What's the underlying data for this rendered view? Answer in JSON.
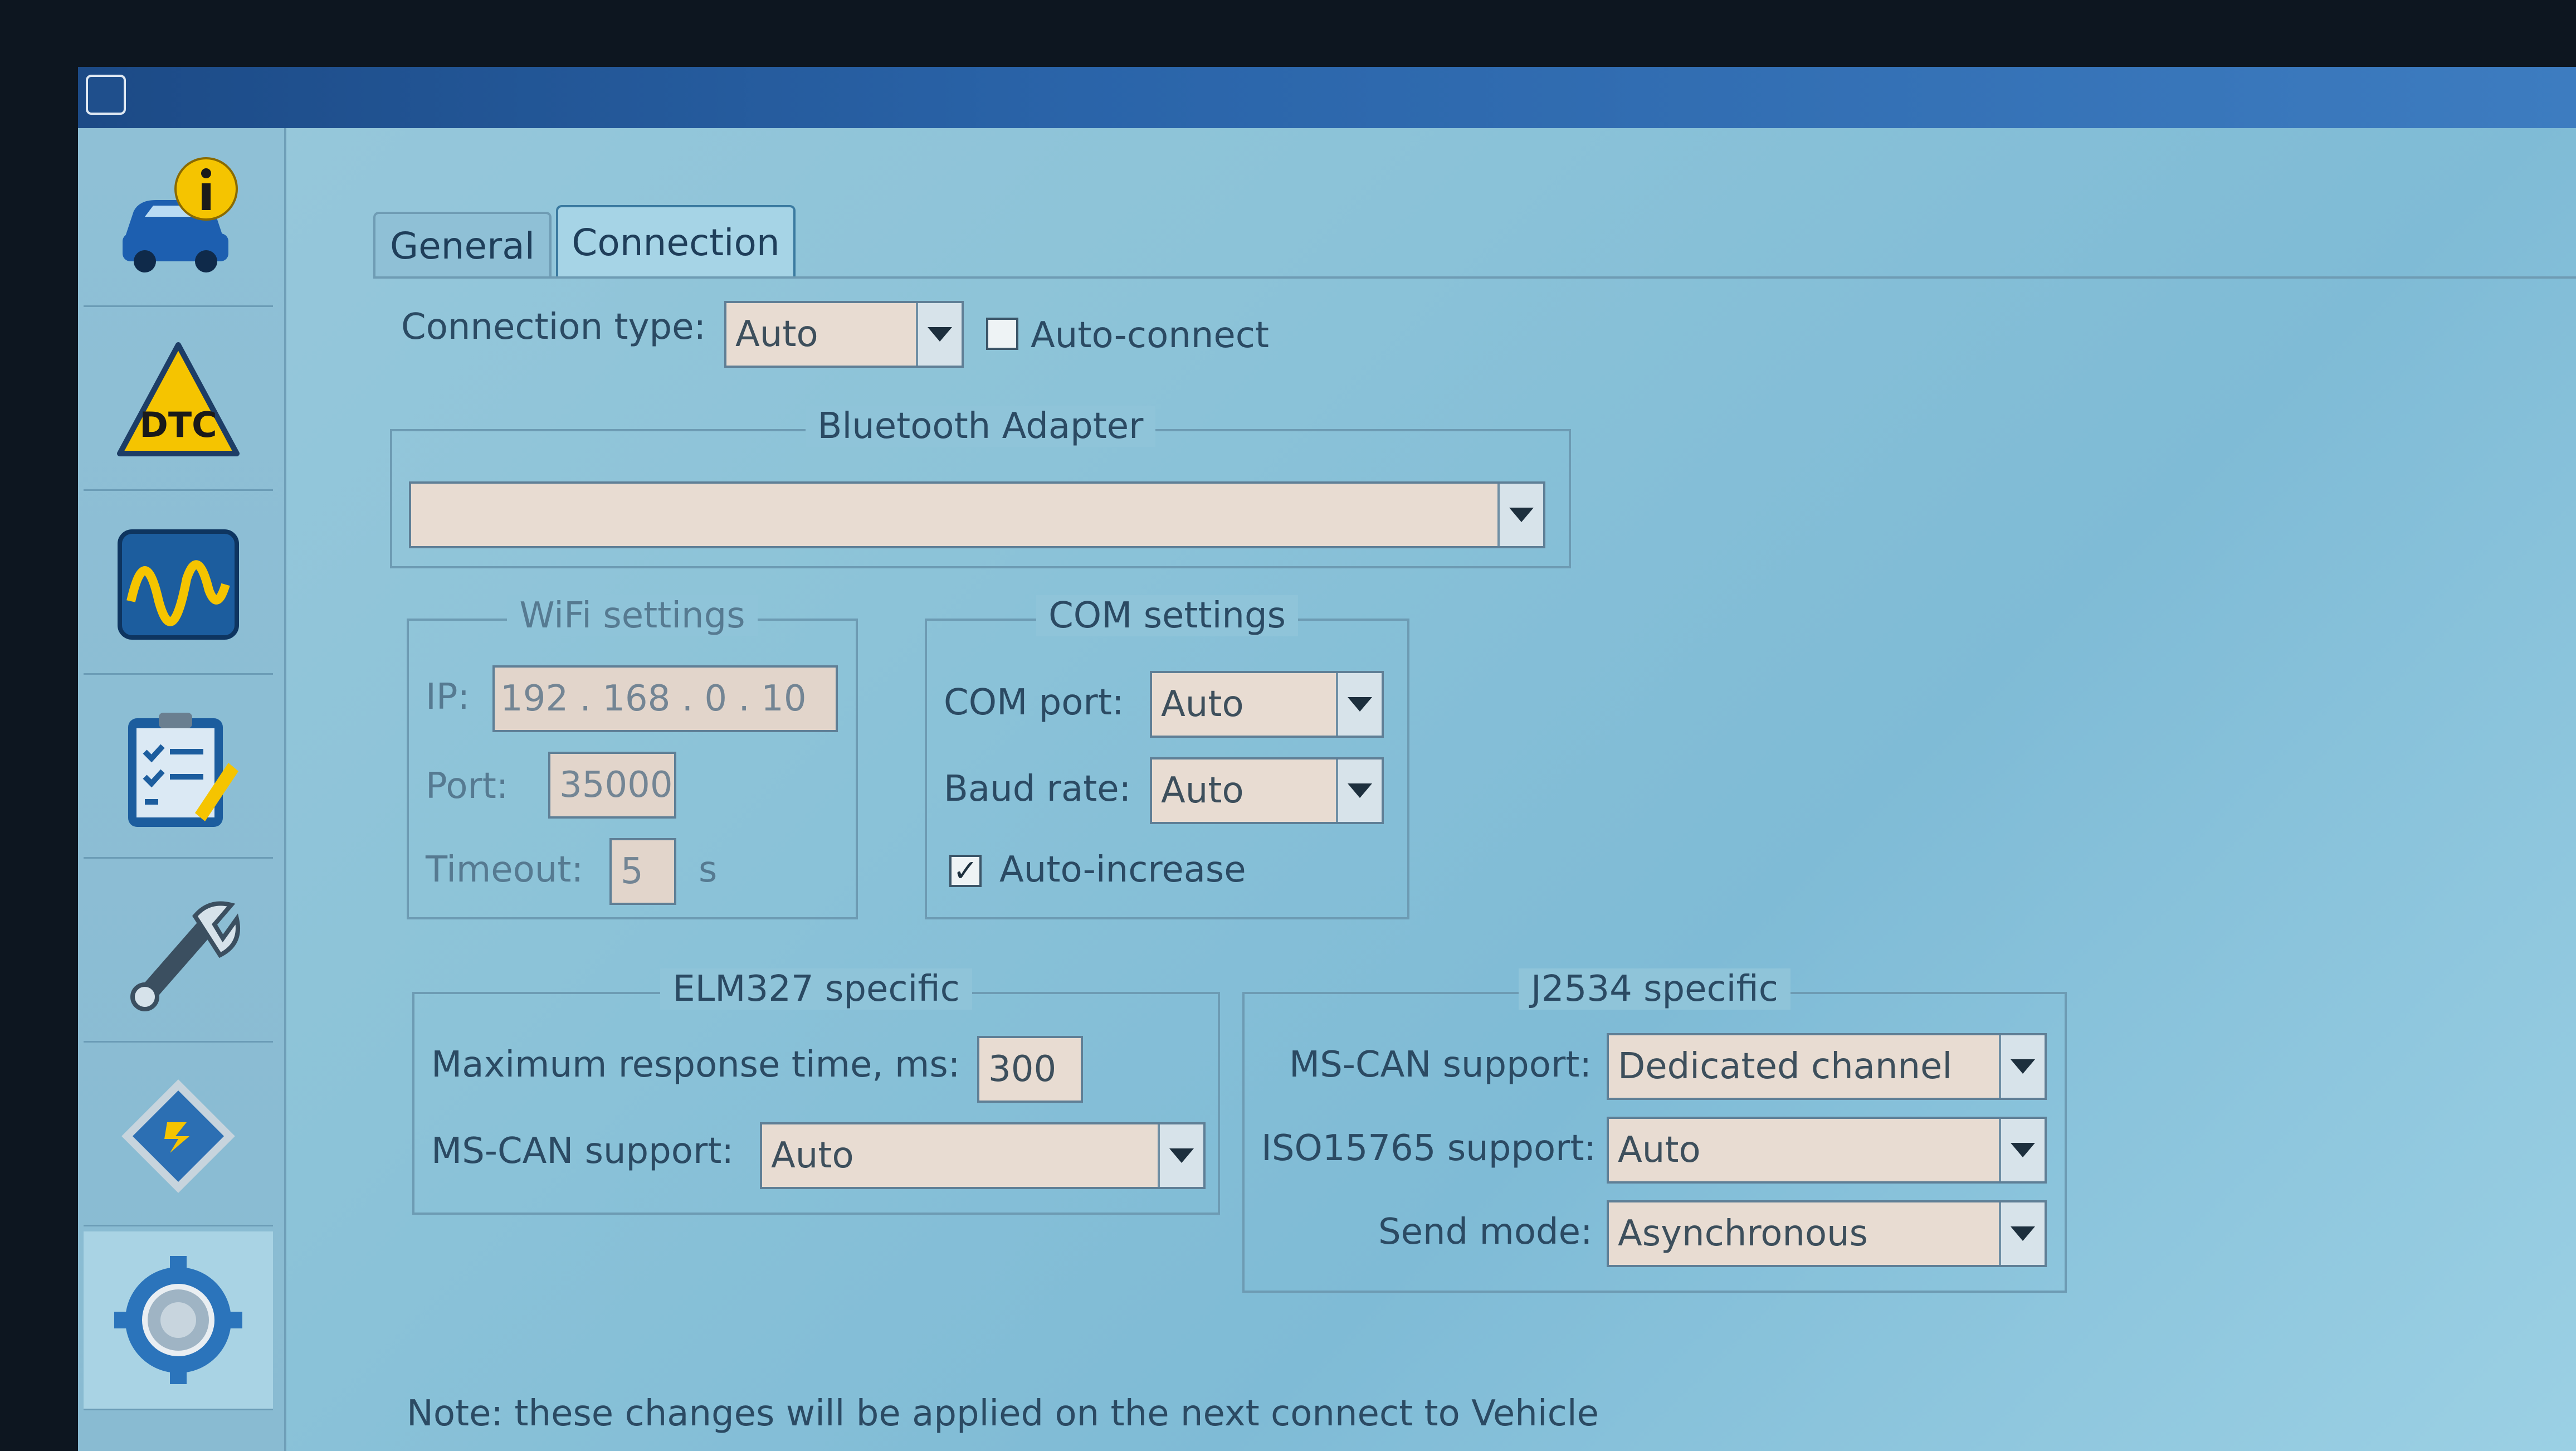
{
  "sidebar": {
    "items": [
      {
        "icon": "vehicle-info-icon"
      },
      {
        "icon": "dtc-warning-icon",
        "text": "DTC"
      },
      {
        "icon": "oscilloscope-icon"
      },
      {
        "icon": "checklist-icon"
      },
      {
        "icon": "wrench-icon"
      },
      {
        "icon": "chip-icon"
      },
      {
        "icon": "settings-gear-icon"
      }
    ]
  },
  "tabs": {
    "general": "General",
    "connection": "Connection"
  },
  "connection": {
    "type_label": "Connection type:",
    "type_value": "Auto",
    "auto_connect_label": "Auto-connect",
    "auto_connect_checked": false
  },
  "bluetooth": {
    "title": "Bluetooth Adapter",
    "value": ""
  },
  "wifi": {
    "title": "WiFi settings",
    "ip_label": "IP:",
    "ip_octets": [
      "192",
      "168",
      "0",
      "10"
    ],
    "port_label": "Port:",
    "port_value": "35000",
    "timeout_label": "Timeout:",
    "timeout_value": "5",
    "timeout_unit": "s"
  },
  "com": {
    "title": "COM settings",
    "port_label": "COM port:",
    "port_value": "Auto",
    "baud_label": "Baud rate:",
    "baud_value": "Auto",
    "auto_increase_label": "Auto-increase",
    "auto_increase_checked": true
  },
  "elm327": {
    "title": "ELM327 specific",
    "max_response_label": "Maximum response time, ms:",
    "max_response_value": "300",
    "mscan_label": "MS-CAN support:",
    "mscan_value": "Auto"
  },
  "j2534": {
    "title": "J2534 specific",
    "mscan_label": "MS-CAN support:",
    "mscan_value": "Dedicated channel",
    "iso_label": "ISO15765 support:",
    "iso_value": "Auto",
    "send_label": "Send mode:",
    "send_value": "Asynchronous"
  },
  "note": "Note: these changes will be applied on the next connect to Vehicle"
}
